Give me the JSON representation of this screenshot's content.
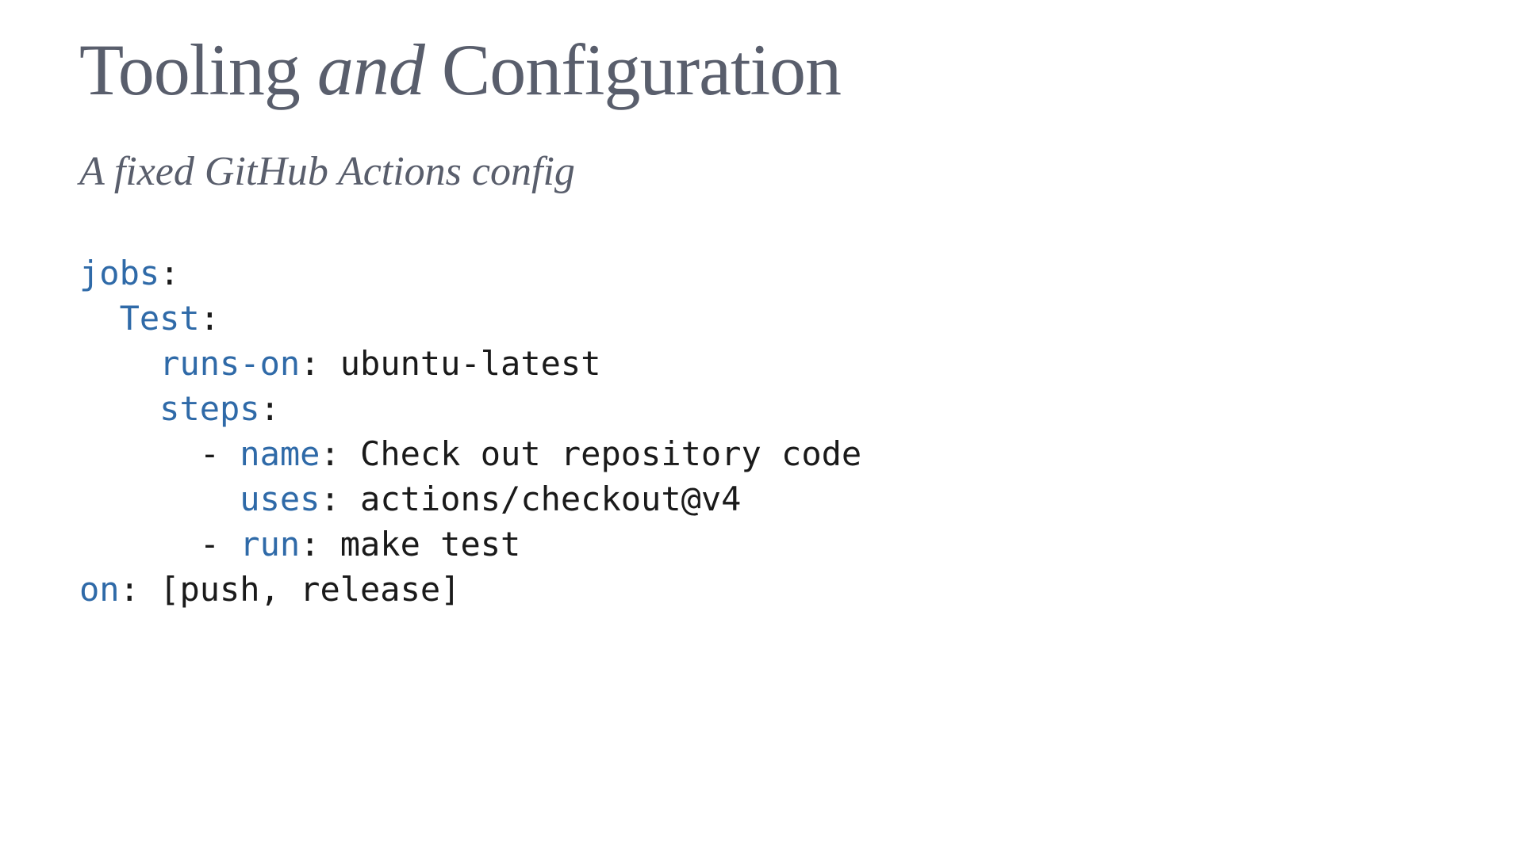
{
  "title": {
    "part1": "Tooling ",
    "italic": "and",
    "part2": " Configuration"
  },
  "subtitle": "A fixed GitHub Actions config",
  "code": {
    "k_jobs": "jobs",
    "k_Test": "Test",
    "k_runs_on": "runs-on",
    "v_runs_on": " ubuntu-latest",
    "k_steps": "steps",
    "k_name": "name",
    "v_name": " Check out repository code",
    "k_uses": "uses",
    "v_uses": " actions/checkout@v4",
    "k_run": "run",
    "v_run": " make test",
    "k_on": "on",
    "v_on": " [push, release]"
  }
}
